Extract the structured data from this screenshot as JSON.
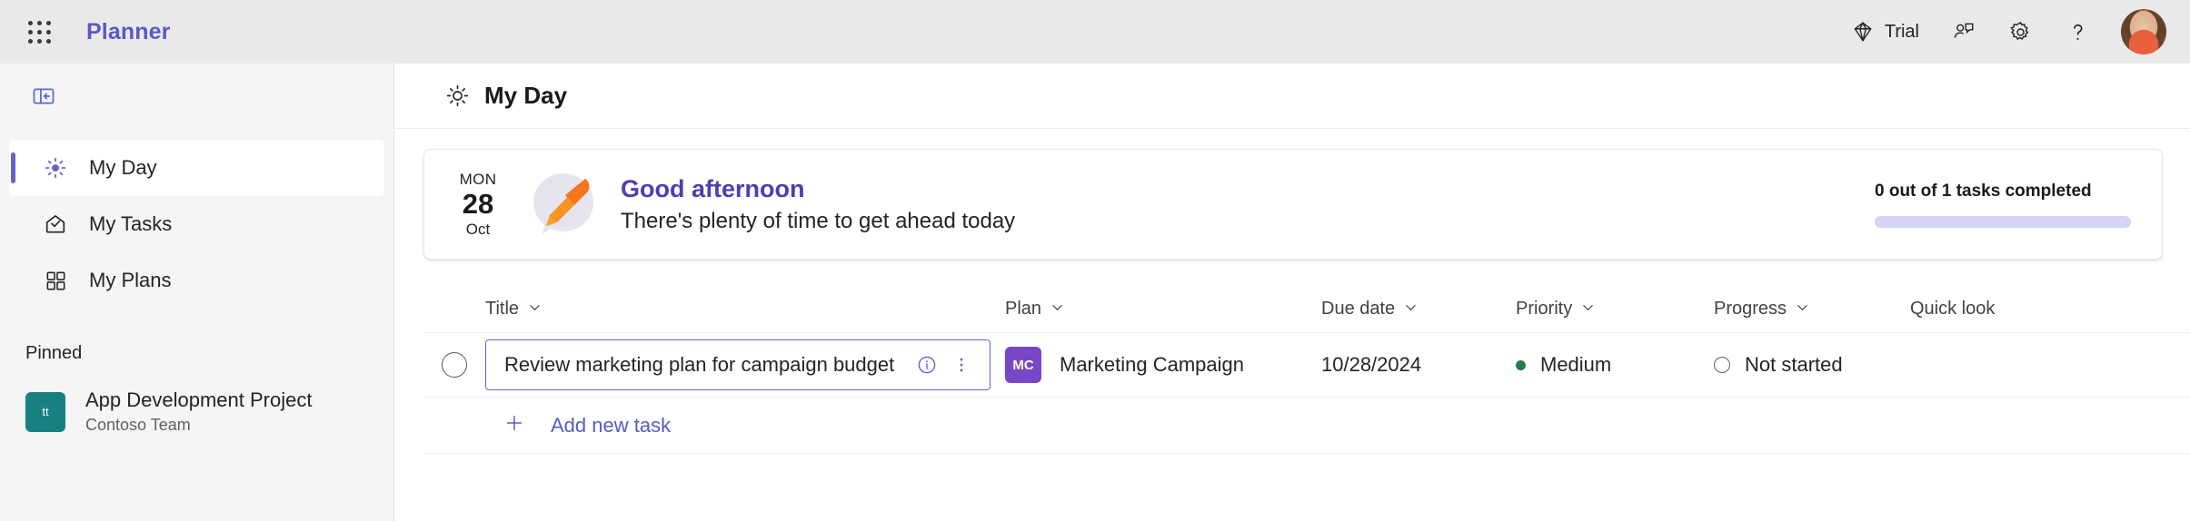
{
  "header": {
    "waffle_icon": "app-launcher-icon",
    "app_title": "Planner",
    "trial_label": "Trial",
    "trial_icon": "diamond-icon",
    "feedback_icon": "person-feedback-icon",
    "settings_icon": "gear-icon",
    "help_icon": "question-mark-icon",
    "avatar": "user-avatar-photo"
  },
  "sidebar": {
    "collapse_icon": "collapse-panel-icon",
    "items": [
      {
        "label": "My Day",
        "icon": "sun-icon",
        "active": true
      },
      {
        "label": "My Tasks",
        "icon": "envelope-check-icon",
        "active": false
      },
      {
        "label": "My Plans",
        "icon": "grid-squares-icon",
        "active": false
      }
    ],
    "pinned_header": "Pinned",
    "pinned": [
      {
        "name": "App Development Project",
        "subtitle": "Contoso Team",
        "initials": "tt",
        "color": "#18817f"
      }
    ]
  },
  "main": {
    "page_title": "My Day",
    "page_title_icon": "sun-icon",
    "greeting": {
      "day_of_week": "MON",
      "day_number": "28",
      "month": "Oct",
      "title": "Good afternoon",
      "subtitle": "There's plenty of time to get ahead today",
      "illustration": "pencil-speech-bubble-illustration",
      "progress_label": "0 out of 1 tasks completed",
      "progress_percent": 0
    },
    "table": {
      "columns": [
        {
          "label": "Title",
          "sortable": true
        },
        {
          "label": "Plan",
          "sortable": true
        },
        {
          "label": "Due date",
          "sortable": true
        },
        {
          "label": "Priority",
          "sortable": true
        },
        {
          "label": "Progress",
          "sortable": true
        },
        {
          "label": "Quick look",
          "sortable": false
        }
      ],
      "rows": [
        {
          "completed": false,
          "title": "Review marketing plan for campaign budget",
          "info_icon": "info-circle-icon",
          "more_icon": "more-vertical-icon",
          "plan_name": "Marketing Campaign",
          "plan_initials": "MC",
          "plan_color": "#7a46c8",
          "due_date": "10/28/2024",
          "priority": "Medium",
          "priority_color": "#237b4b",
          "progress": "Not started",
          "quick_look": ""
        }
      ],
      "add_task_label": "Add new task",
      "add_task_icon": "plus-icon"
    }
  },
  "colors": {
    "accent_purple": "#585ac4",
    "greeting_purple": "#4b3fb3",
    "indicator_purple": "#6264cb",
    "header_bg": "#e9e9e9",
    "sidebar_bg": "#f5f5f5"
  }
}
